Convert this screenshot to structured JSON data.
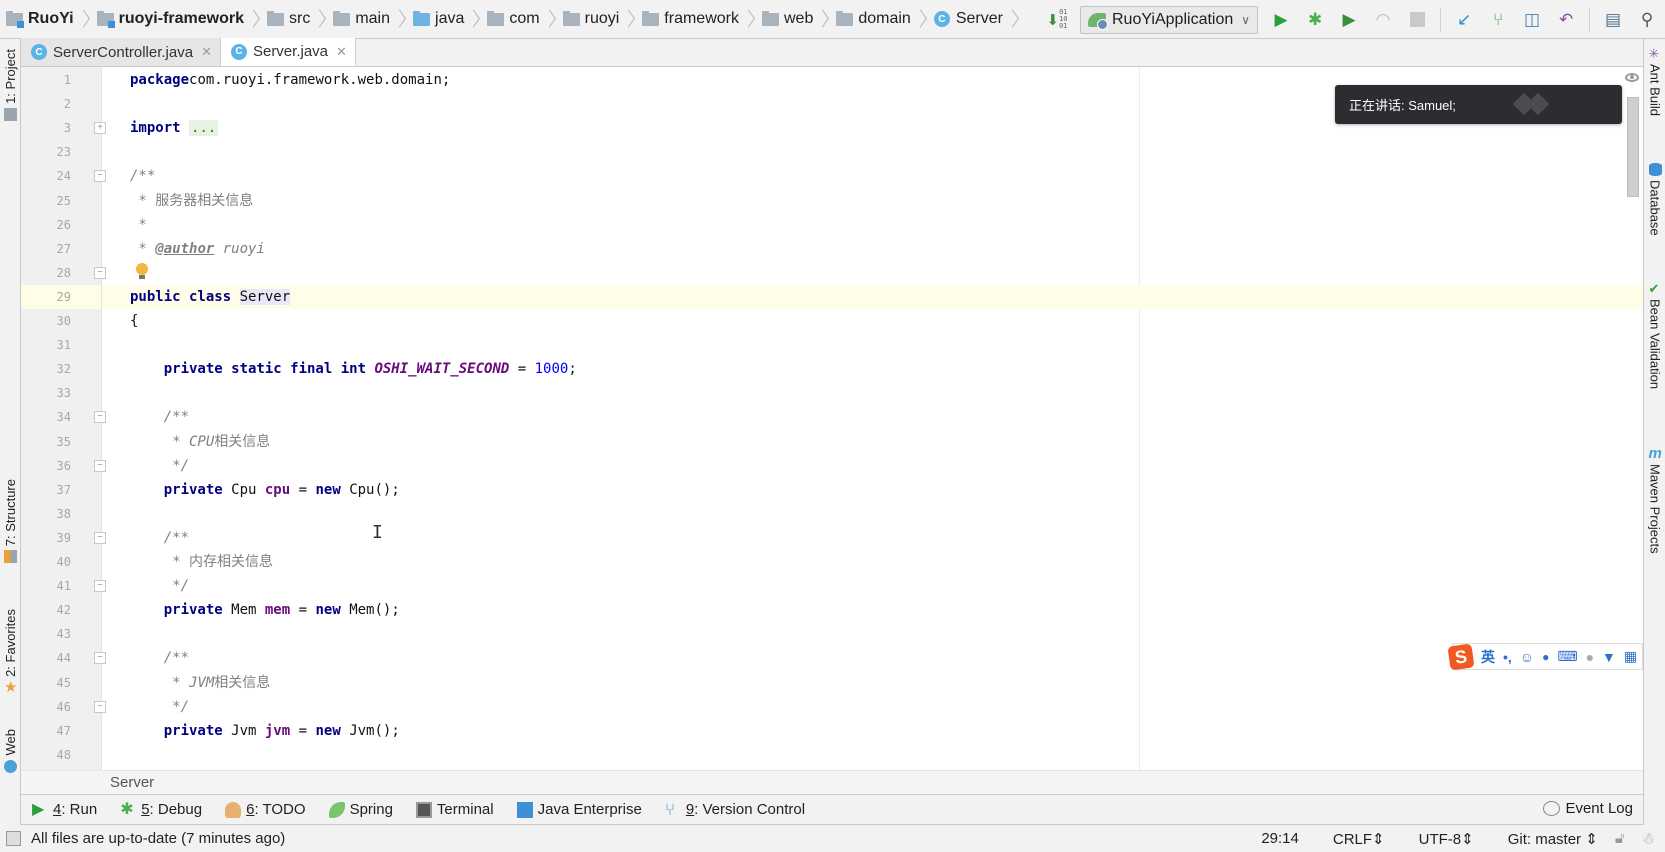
{
  "navbar": {
    "breadcrumbs": [
      {
        "label": "RuoYi",
        "icon": "module-icon",
        "bold": true
      },
      {
        "label": "ruoyi-framework",
        "icon": "module-icon",
        "bold": true
      },
      {
        "label": "src",
        "icon": "folder-icon"
      },
      {
        "label": "main",
        "icon": "folder-icon"
      },
      {
        "label": "java",
        "icon": "source-folder-icon"
      },
      {
        "label": "com",
        "icon": "package-icon"
      },
      {
        "label": "ruoyi",
        "icon": "package-icon"
      },
      {
        "label": "framework",
        "icon": "package-icon"
      },
      {
        "label": "web",
        "icon": "package-icon"
      },
      {
        "label": "domain",
        "icon": "package-icon"
      },
      {
        "label": "Server",
        "icon": "class-icon"
      }
    ],
    "class_badge": "C",
    "run_config": "RuoYiApplication",
    "toolbar_icons": [
      "build-icon",
      "run-icon",
      "debug-icon",
      "coverage-icon",
      "profile-icon",
      "stop-icon",
      "vcs-update-icon",
      "vcs-commit-icon",
      "vcs-history-icon",
      "revert-icon",
      "project-structure-icon",
      "search-icon"
    ]
  },
  "left_strip": {
    "tabs": [
      {
        "label": "1: Project",
        "icon": "project-icon"
      },
      {
        "label": "7: Structure",
        "icon": "structure-icon"
      },
      {
        "label": "2: Favorites",
        "icon": "star-icon"
      },
      {
        "label": "Web",
        "icon": "web-icon"
      }
    ]
  },
  "right_strip": {
    "tabs": [
      {
        "label": "Ant Build",
        "icon": "ant-icon"
      },
      {
        "label": "Database",
        "icon": "database-icon"
      },
      {
        "label": "Bean Validation",
        "icon": "bean-icon"
      },
      {
        "label": "Maven Projects",
        "icon": "maven-icon"
      }
    ]
  },
  "editor_tabs": [
    {
      "label": "ServerController.java",
      "active": false
    },
    {
      "label": "Server.java",
      "active": true
    }
  ],
  "editor": {
    "current_line": "29",
    "lines": [
      {
        "n": "1",
        "code": [
          [
            "kw",
            "package"
          ],
          [
            "",
            "com.ruoyi.framework.web.domain;"
          ]
        ]
      },
      {
        "n": "2",
        "code": []
      },
      {
        "n": "3",
        "code": [
          [
            "kw",
            "import"
          ],
          [
            "",
            " "
          ],
          [
            "fold-dots",
            "..."
          ]
        ],
        "fold": "+"
      },
      {
        "n": "23",
        "code": []
      },
      {
        "n": "24",
        "code": [
          [
            "cm",
            "/**"
          ]
        ],
        "fold": "-"
      },
      {
        "n": "25",
        "code": [
          [
            "cm",
            " * "
          ],
          [
            "cmcn",
            "服务器相关信息"
          ]
        ]
      },
      {
        "n": "26",
        "code": [
          [
            "cm",
            " *"
          ]
        ]
      },
      {
        "n": "27",
        "code": [
          [
            "cm",
            " * "
          ],
          [
            "tag",
            "@author"
          ],
          [
            "cm",
            " ruoyi"
          ]
        ]
      },
      {
        "n": "28",
        "code": [],
        "fold": "-",
        "bulb": true
      },
      {
        "n": "29",
        "code": [
          [
            "kw",
            "public class "
          ],
          [
            "ident-hl",
            "Server"
          ]
        ]
      },
      {
        "n": "30",
        "code": [
          [
            "",
            "{"
          ]
        ]
      },
      {
        "n": "31",
        "code": []
      },
      {
        "n": "32",
        "code": [
          [
            "",
            "    "
          ],
          [
            "kw",
            "private static final int "
          ],
          [
            "const",
            "OSHI_WAIT_SECOND"
          ],
          [
            "",
            " = "
          ],
          [
            "num",
            "1000"
          ],
          [
            "",
            ";"
          ]
        ]
      },
      {
        "n": "33",
        "code": []
      },
      {
        "n": "34",
        "code": [
          [
            "",
            "    "
          ],
          [
            "cm",
            "/**"
          ]
        ],
        "fold": "-"
      },
      {
        "n": "35",
        "code": [
          [
            "",
            "    "
          ],
          [
            "cm",
            " * CPU"
          ],
          [
            "cmcn",
            "相关信息"
          ]
        ]
      },
      {
        "n": "36",
        "code": [
          [
            "",
            "    "
          ],
          [
            "cm",
            " */"
          ]
        ],
        "fold": "-"
      },
      {
        "n": "37",
        "code": [
          [
            "",
            "    "
          ],
          [
            "kw",
            "private "
          ],
          [
            "",
            "Cpu "
          ],
          [
            "field",
            "cpu"
          ],
          [
            "",
            " = "
          ],
          [
            "kw",
            "new "
          ],
          [
            "",
            "Cpu();"
          ]
        ]
      },
      {
        "n": "38",
        "code": []
      },
      {
        "n": "39",
        "code": [
          [
            "",
            "    "
          ],
          [
            "cm",
            "/**"
          ]
        ],
        "fold": "-"
      },
      {
        "n": "40",
        "code": [
          [
            "",
            "    "
          ],
          [
            "cm",
            " * "
          ],
          [
            "cmcn",
            "内存相关信息"
          ]
        ]
      },
      {
        "n": "41",
        "code": [
          [
            "",
            "    "
          ],
          [
            "cm",
            " */"
          ]
        ],
        "fold": "-"
      },
      {
        "n": "42",
        "code": [
          [
            "",
            "    "
          ],
          [
            "kw",
            "private "
          ],
          [
            "",
            "Mem "
          ],
          [
            "field",
            "mem"
          ],
          [
            "",
            " = "
          ],
          [
            "kw",
            "new "
          ],
          [
            "",
            "Mem();"
          ]
        ]
      },
      {
        "n": "43",
        "code": []
      },
      {
        "n": "44",
        "code": [
          [
            "",
            "    "
          ],
          [
            "cm",
            "/**"
          ]
        ],
        "fold": "-"
      },
      {
        "n": "45",
        "code": [
          [
            "",
            "    "
          ],
          [
            "cm",
            " * JVM"
          ],
          [
            "cmcn",
            "相关信息"
          ]
        ]
      },
      {
        "n": "46",
        "code": [
          [
            "",
            "    "
          ],
          [
            "cm",
            " */"
          ]
        ],
        "fold": "-"
      },
      {
        "n": "47",
        "code": [
          [
            "",
            "    "
          ],
          [
            "kw",
            "private "
          ],
          [
            "",
            "Jvm "
          ],
          [
            "field",
            "jvm"
          ],
          [
            "",
            " = "
          ],
          [
            "kw",
            "new "
          ],
          [
            "",
            "Jvm();"
          ]
        ]
      },
      {
        "n": "48",
        "code": []
      }
    ]
  },
  "toast": {
    "text": "正在讲话: Samuel;"
  },
  "ime": {
    "items": [
      "英",
      "•,",
      "☺",
      "🎤",
      "⌨",
      "👤",
      "👕",
      "▦"
    ]
  },
  "editor_breadcrumb": "Server",
  "tool_windows": [
    {
      "num": "4",
      "label": ": Run",
      "icon": "run-icon"
    },
    {
      "num": "5",
      "label": ": Debug",
      "icon": "debug-icon"
    },
    {
      "num": "6",
      "label": ": TODO",
      "icon": "todo-icon"
    },
    {
      "num": "",
      "label": "Spring",
      "icon": "spring-icon"
    },
    {
      "num": "",
      "label": "Terminal",
      "icon": "terminal-icon"
    },
    {
      "num": "",
      "label": "Java Enterprise",
      "icon": "java-enterprise-icon"
    },
    {
      "num": "9",
      "label": ": Version Control",
      "icon": "version-control-icon"
    }
  ],
  "event_log": "Event Log",
  "status": {
    "message": "All files are up-to-date (7 minutes ago)",
    "position": "29:14",
    "line_separator": "CRLF",
    "encoding": "UTF-8",
    "vcs_branch": "Git: master"
  },
  "colors": {
    "keyword": "#000080",
    "comment": "#808080",
    "constant": "#660e7a",
    "number": "#0000ff",
    "current_line": "#fffde7",
    "accent": "#5ab4e6"
  }
}
